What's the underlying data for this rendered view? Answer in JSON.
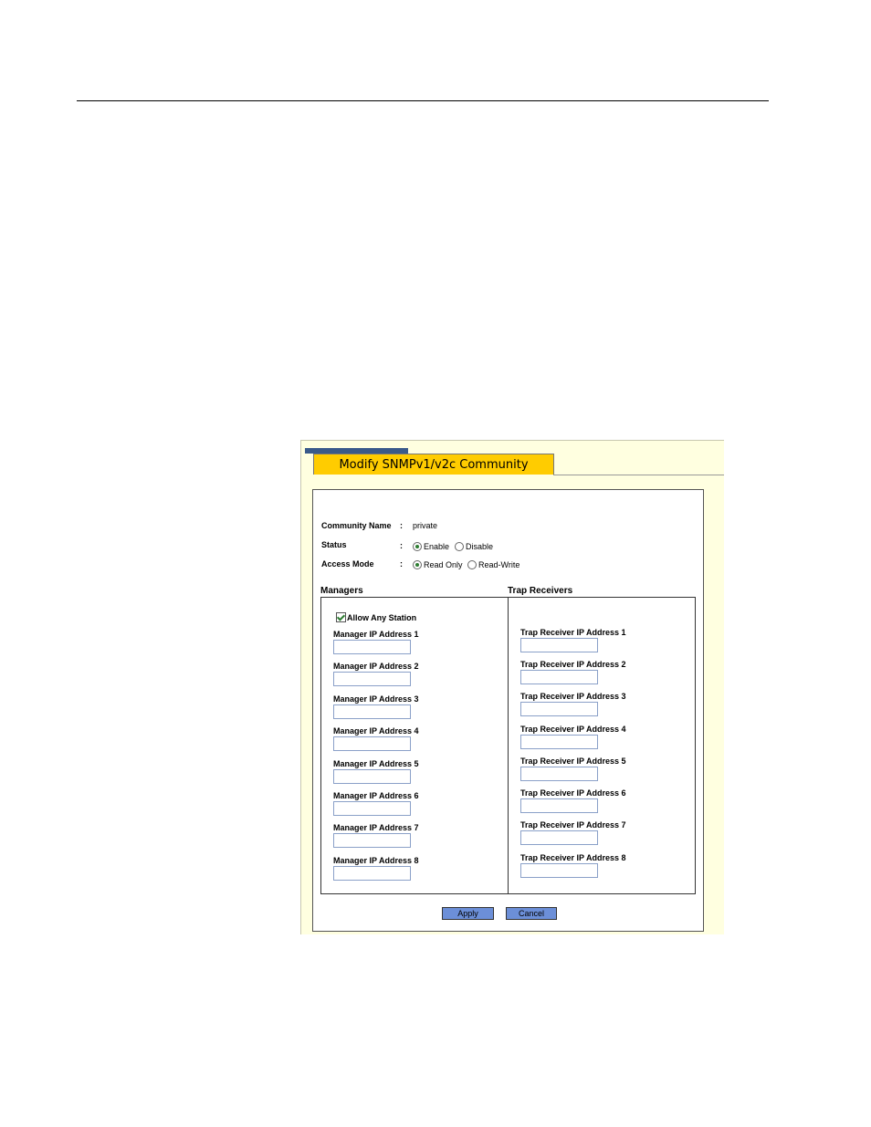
{
  "dialog": {
    "title": "Modify SNMPv1/v2c Community"
  },
  "form": {
    "community_name_label": "Community Name",
    "community_name_value": "private",
    "status_label": "Status",
    "status_options": [
      "Enable",
      "Disable"
    ],
    "status_selected": "Enable",
    "access_mode_label": "Access Mode",
    "access_mode_options": [
      "Read Only",
      "Read-Write"
    ],
    "access_mode_selected": "Read Only",
    "separator": ":"
  },
  "managers": {
    "title": "Managers",
    "allow_any_station_label": "Allow Any Station",
    "allow_any_station_checked": true,
    "fields": [
      "Manager IP Address 1",
      "Manager IP Address 2",
      "Manager IP Address 3",
      "Manager IP Address 4",
      "Manager IP Address 5",
      "Manager IP Address 6",
      "Manager IP Address 7",
      "Manager IP Address 8"
    ]
  },
  "trap_receivers": {
    "title": "Trap Receivers",
    "fields": [
      "Trap Receiver IP Address 1",
      "Trap Receiver IP Address 2",
      "Trap Receiver IP Address 3",
      "Trap Receiver IP Address 4",
      "Trap Receiver IP Address 5",
      "Trap Receiver IP Address 6",
      "Trap Receiver IP Address 7",
      "Trap Receiver IP Address 8"
    ]
  },
  "buttons": {
    "apply": "Apply",
    "cancel": "Cancel"
  }
}
